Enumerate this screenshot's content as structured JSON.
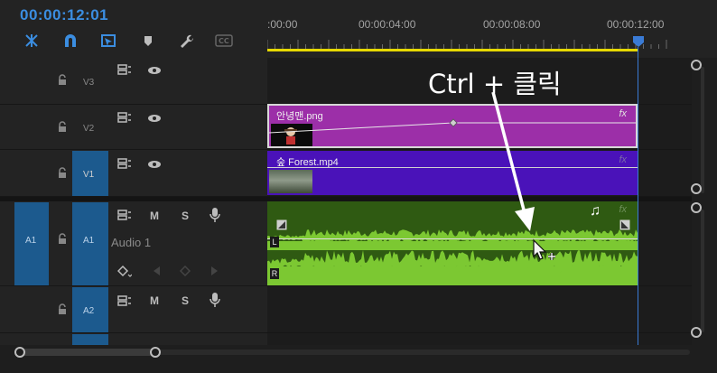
{
  "header": {
    "timecode": "00:00:12:01",
    "tools": [
      "snap-icon",
      "magnet-icon",
      "linked-selection-icon",
      "marker-icon",
      "wrench-icon",
      "captions-icon"
    ],
    "ruler_labels": [
      ":00:00",
      "00:00:04:00",
      "00:00:08:00",
      "00:00:12:00"
    ]
  },
  "tracks": {
    "v3": {
      "name": "V3"
    },
    "v2": {
      "name": "V2"
    },
    "v1": {
      "name": "V1"
    },
    "a1": {
      "source": "A1",
      "name": "A1",
      "title": "Audio 1",
      "m": "M",
      "s": "S"
    },
    "a2": {
      "name": "A2",
      "m": "M",
      "s": "S"
    }
  },
  "clips": {
    "v2": {
      "name": "안녕맨.png",
      "fx": "fx"
    },
    "v1": {
      "name": "숲 Forest.mp4",
      "fx": "fx"
    },
    "a1": {
      "fx": "fx",
      "left_channel": "L",
      "right_channel": "R"
    }
  },
  "annotation": "Ctrl + 클릭",
  "colors": {
    "accent": "#3b8de0",
    "v2_clip": "#9c2fa8",
    "v1_clip": "#4a12b9",
    "audio_clip": "#2f5a12",
    "waveform": "#7cc832",
    "work_area": "#e6d800"
  }
}
